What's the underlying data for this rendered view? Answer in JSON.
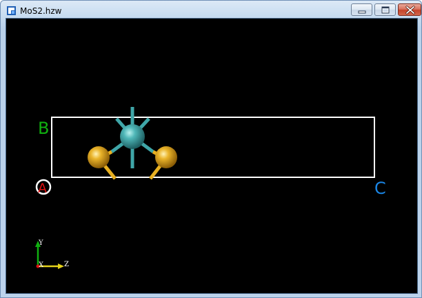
{
  "window": {
    "title": "MoS2.hzw",
    "icon": "app-icon",
    "controls": {
      "minimize_icon": "minimize-icon",
      "maximize_icon": "maximize-icon",
      "close_icon": "close-icon"
    }
  },
  "viewer": {
    "background": "#000000",
    "cell_axis_labels": {
      "a": "A",
      "b": "B",
      "c": "C"
    },
    "cell_label_colors": {
      "a": "#e01010",
      "b": "#10b010",
      "c": "#1a86e6"
    },
    "atoms": [
      {
        "element": "Mo",
        "color": "#3fa6a8"
      },
      {
        "element": "S",
        "color": "#e8b021"
      },
      {
        "element": "S",
        "color": "#e8b021"
      }
    ],
    "axis_triad": {
      "x": "X",
      "y": "Y",
      "z": "Z",
      "colors": {
        "x": "#e01010",
        "y": "#10b010",
        "z": "#e5d21a"
      }
    }
  }
}
